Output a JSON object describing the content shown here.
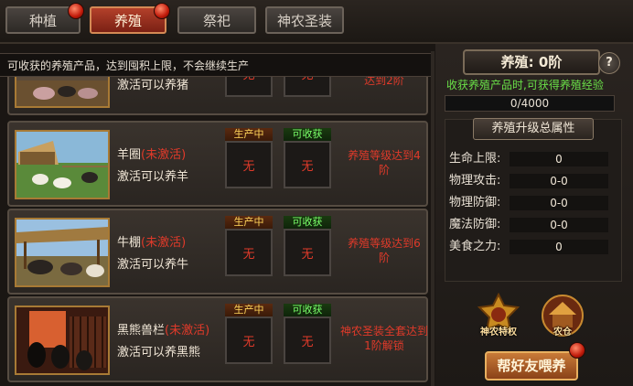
{
  "tabs": [
    {
      "label": "种植",
      "active": false,
      "badge": true
    },
    {
      "label": "养殖",
      "active": true,
      "badge": true
    },
    {
      "label": "祭祀",
      "active": false,
      "badge": false
    },
    {
      "label": "神农圣装",
      "active": false,
      "badge": false
    }
  ],
  "hint": "可收获的养殖产品，达到囤积上限，不会继续生产",
  "slot_labels": {
    "producing": "生产中",
    "harvestable": "可收获"
  },
  "pens": [
    {
      "name": "",
      "status": "",
      "desc": "激活可以养猪",
      "produce": "无",
      "harvest": "无",
      "condition": "达到2阶",
      "partial": true
    },
    {
      "name": "羊圈",
      "status": "(未激活)",
      "desc": "激活可以养羊",
      "produce": "无",
      "harvest": "无",
      "condition": "养殖等级达到4阶"
    },
    {
      "name": "牛棚",
      "status": "(未激活)",
      "desc": "激活可以养牛",
      "produce": "无",
      "harvest": "无",
      "condition": "养殖等级达到6阶"
    },
    {
      "name": "黑熊兽栏",
      "status": "(未激活)",
      "desc": "激活可以养黑熊",
      "produce": "无",
      "harvest": "无",
      "condition": "神农圣装全套达到1阶解锁"
    }
  ],
  "panel": {
    "title": "养殖: 0阶",
    "help": "?",
    "info": "收获养殖产品时,可获得养殖经验",
    "exp": "0/4000",
    "attr_title": "养殖升级总属性",
    "attrs": [
      {
        "label": "生命上限:",
        "value": "0"
      },
      {
        "label": "物理攻击:",
        "value": "0-0"
      },
      {
        "label": "物理防御:",
        "value": "0-0"
      },
      {
        "label": "魔法防御:",
        "value": "0-0"
      },
      {
        "label": "美食之力:",
        "value": "0"
      }
    ],
    "btn_privilege": "神农特权",
    "btn_warehouse": "农仓",
    "btn_feed": "帮好友喂养"
  }
}
